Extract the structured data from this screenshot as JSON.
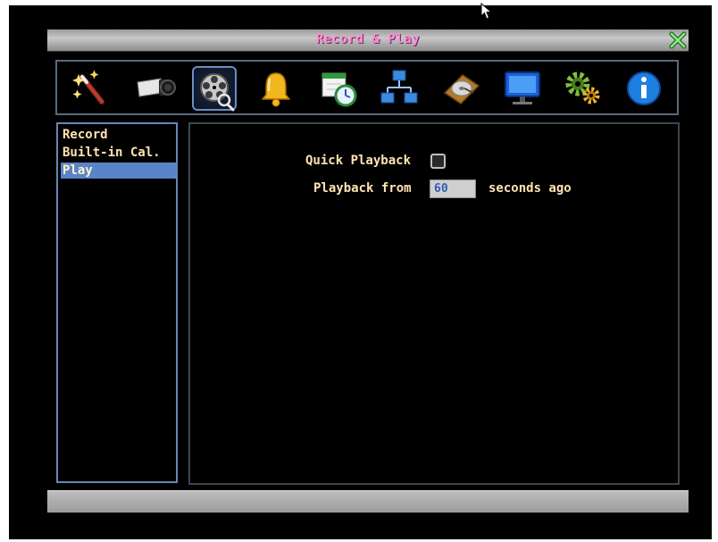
{
  "window": {
    "title": "Record & Play"
  },
  "toolbar": {
    "icons": [
      "magic-wand-icon",
      "camera-icon",
      "film-reel-icon",
      "bell-icon",
      "schedule-icon",
      "network-icon",
      "hard-disk-icon",
      "monitor-icon",
      "gears-icon",
      "info-icon"
    ],
    "active_index": 2
  },
  "sidebar": {
    "items": [
      {
        "label": "Record",
        "selected": false
      },
      {
        "label": "Built-in Cal.",
        "selected": false
      },
      {
        "label": "Play",
        "selected": true
      }
    ]
  },
  "play": {
    "quick_playback_label": "Quick Playback",
    "quick_playback_checked": false,
    "playback_from_label": "Playback from",
    "playback_from_value": "60",
    "seconds_ago_label": "seconds ago"
  },
  "colors": {
    "title_text": "#ff8bd6",
    "label_text": "#ffe3b0",
    "selected_bg": "#5a84c8",
    "input_value": "#2f5fb5"
  }
}
